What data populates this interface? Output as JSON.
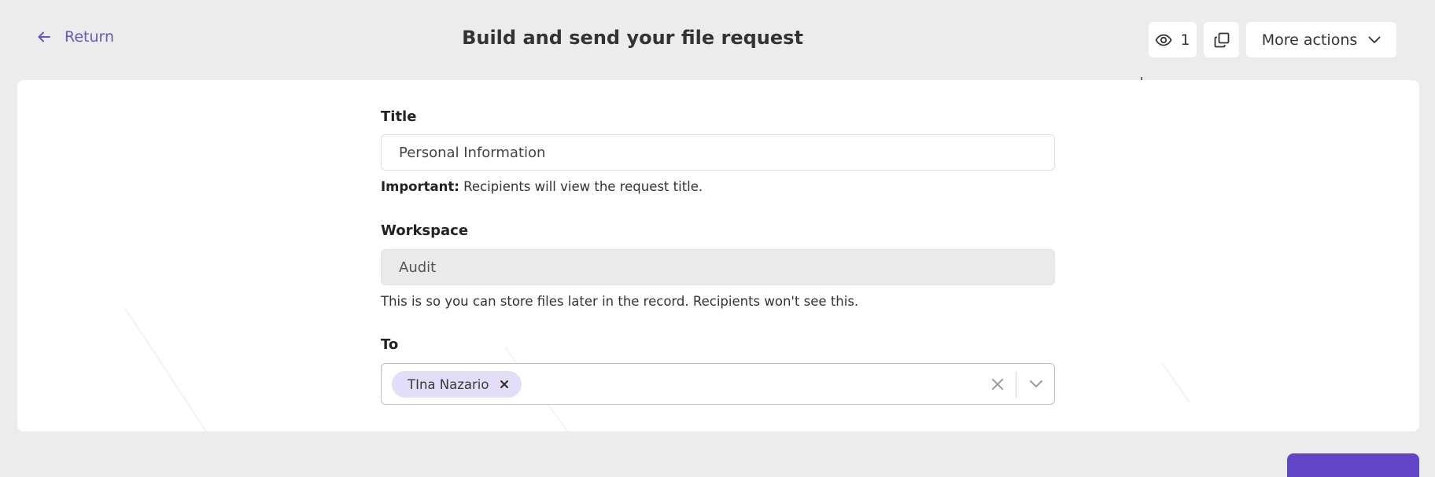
{
  "header": {
    "return_label": "Return",
    "title": "Build and send your file request",
    "viewers_count": "1",
    "more_actions_label": "More actions"
  },
  "form": {
    "title_label": "Title",
    "title_value": "Personal Information",
    "title_help_strong": "Important:",
    "title_help_text": " Recipients will view the request title.",
    "workspace_label": "Workspace",
    "workspace_value": "Audit",
    "workspace_help": "This is so you can store files later in the record. Recipients won't see this.",
    "to_label": "To",
    "recipients": [
      "TIna Nazario"
    ]
  },
  "icons": {
    "return": "arrow-left-icon",
    "viewers": "eye-icon",
    "copy": "copy-icon",
    "more": "chevron-down-icon",
    "chip_remove": "close-icon",
    "clear": "close-icon",
    "dropdown": "chevron-down-icon"
  },
  "colors": {
    "accent": "#6a55c2",
    "chip_bg": "#e4ddfa",
    "primary_button": "#6246c8",
    "page_bg": "#ececed"
  }
}
